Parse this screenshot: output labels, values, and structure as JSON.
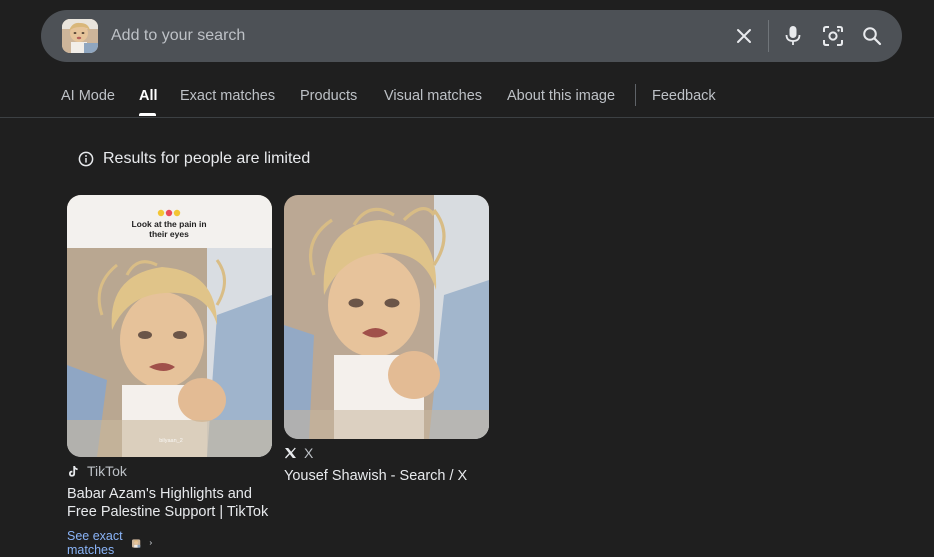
{
  "search": {
    "placeholder": "Add to your search",
    "icons": [
      "clear-icon",
      "mic-icon",
      "lens-icon",
      "search-icon"
    ]
  },
  "tabs": [
    {
      "label": "AI Mode"
    },
    {
      "label": "All",
      "active": true
    },
    {
      "label": "Exact matches"
    },
    {
      "label": "Products"
    },
    {
      "label": "Visual matches"
    },
    {
      "label": "About this image"
    },
    {
      "label": "Feedback"
    }
  ],
  "notice": {
    "text": "Results for people are limited",
    "icon": "info-icon"
  },
  "results": [
    {
      "overlay_text_line1": "Look at the pain in",
      "overlay_text_line2": "their eyes",
      "watermark": "bilyaan_2",
      "source": "TikTok",
      "source_icon": "tiktok-icon",
      "title_line1": "Babar Azam's Highlights and",
      "title_line2": "Free Palestine Support | TikTok",
      "exact_link": "See exact matches"
    },
    {
      "source": "X",
      "source_icon": "x-logo-icon",
      "title_line1": "Yousef Shawish - Search / X"
    }
  ],
  "colors": {
    "background": "#1f1f1f",
    "searchbar": "#4d5156",
    "link": "#8ab4f8"
  }
}
